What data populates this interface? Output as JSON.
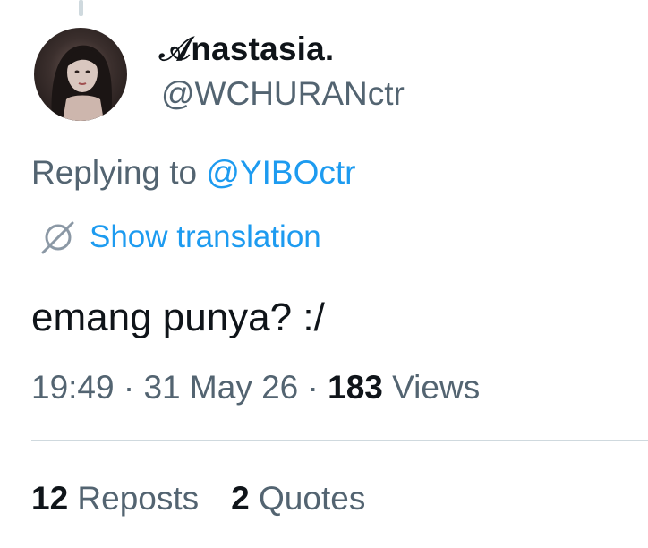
{
  "author": {
    "display_name": "𝒜nastasia.",
    "handle": "@WCHURANctr"
  },
  "reply": {
    "prefix": "Replying to ",
    "mention": "@YIBOctr"
  },
  "translation": {
    "label": "Show translation",
    "icon": "globe-slash-icon"
  },
  "tweet": {
    "text": "emang punya? :/"
  },
  "meta": {
    "time": "19:49",
    "separator": " · ",
    "date": "31 May 26",
    "views_count": "183",
    "views_label": " Views"
  },
  "stats": {
    "reposts_count": "12",
    "reposts_label": " Reposts",
    "quotes_count": "2",
    "quotes_label": " Quotes"
  },
  "colors": {
    "text_primary": "#0f1419",
    "text_secondary": "#536471",
    "link": "#1d9bf0",
    "divider": "#cfd9de"
  }
}
